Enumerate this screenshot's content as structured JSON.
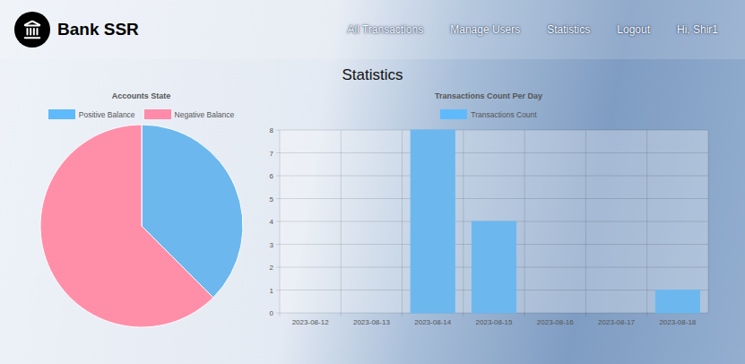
{
  "header": {
    "brand": "Bank SSR",
    "nav": [
      {
        "label": "All Transactions"
      },
      {
        "label": "Manage Users"
      },
      {
        "label": "Statistics"
      },
      {
        "label": "Logout"
      }
    ],
    "greeting": "Hi, Shir1"
  },
  "page": {
    "title": "Statistics"
  },
  "pie_chart": {
    "title": "Accounts State",
    "series": [
      {
        "label": "Positive Balance",
        "value": 3,
        "color": "#6cb8ee"
      },
      {
        "label": "Negative Balance",
        "value": 5,
        "color": "#ff8fa9"
      }
    ]
  },
  "bar_chart": {
    "title": "Transactions Count Per Day",
    "series": [
      {
        "label": "Transactions Count",
        "color": "#6cb8ee",
        "values": [
          0,
          0,
          8,
          4,
          0,
          0,
          1
        ]
      }
    ],
    "y_ticks": [
      "0",
      "1",
      "2",
      "3",
      "4",
      "5",
      "6",
      "7",
      "8"
    ],
    "x_labels": [
      "2023-08-12",
      "2023-08-13",
      "2023-08-14",
      "2023-08-15",
      "2023-08-16",
      "2023-08-17",
      "2023-08-18"
    ]
  }
}
